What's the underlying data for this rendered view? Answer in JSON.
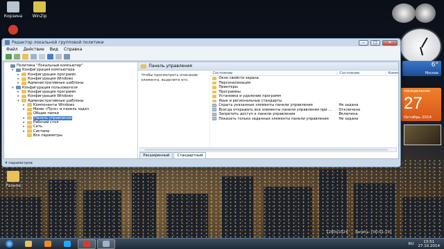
{
  "desktop_icons": [
    {
      "label": "Корзина",
      "color": "#b8c4d0"
    },
    {
      "label": "WinZip",
      "color": "#d9c24a"
    },
    {
      "label": "Разное",
      "color": "#e9c05a"
    }
  ],
  "window": {
    "title": "Редактор локальной групповой политики",
    "controls": {
      "minimize": "–",
      "maximize": "□",
      "close": "✕"
    },
    "menu": [
      "Файл",
      "Действие",
      "Вид",
      "Справка"
    ],
    "status": "4 параметров"
  },
  "tree": [
    {
      "label": "Политика \"Локальный компьютер\"",
      "level": 0,
      "icon": "computer-icon",
      "expander": ""
    },
    {
      "label": "Конфигурация компьютера",
      "level": 1,
      "icon": "computer-icon",
      "expander": "▸"
    },
    {
      "label": "Конфигурация программ",
      "level": 2,
      "icon": "folder-icon",
      "expander": "▸"
    },
    {
      "label": "Конфигурация Windows",
      "level": 2,
      "icon": "folder-icon",
      "expander": "▸"
    },
    {
      "label": "Административные шаблоны",
      "level": 2,
      "icon": "folder-icon",
      "expander": "▸"
    },
    {
      "label": "Конфигурация пользователя",
      "level": 1,
      "icon": "computer-icon",
      "expander": "▾"
    },
    {
      "label": "Конфигурация программ",
      "level": 2,
      "icon": "folder-icon",
      "expander": "▸"
    },
    {
      "label": "Конфигурация Windows",
      "level": 2,
      "icon": "folder-icon",
      "expander": "▸"
    },
    {
      "label": "Административные шаблоны",
      "level": 2,
      "icon": "folder-icon",
      "expander": "▾"
    },
    {
      "label": "Компоненты Windows",
      "level": 3,
      "icon": "folder-icon",
      "expander": "▸"
    },
    {
      "label": "Меню «Пуск» и панель задач",
      "level": 3,
      "icon": "folder-icon",
      "expander": "▸"
    },
    {
      "label": "Общие папки",
      "level": 3,
      "icon": "folder-icon",
      "expander": ""
    },
    {
      "label": "Панель управления",
      "level": 3,
      "icon": "folder-icon",
      "expander": "▸",
      "selected": true
    },
    {
      "label": "Рабочий стол",
      "level": 3,
      "icon": "folder-icon",
      "expander": "▸"
    },
    {
      "label": "Сеть",
      "level": 3,
      "icon": "folder-icon",
      "expander": "▸"
    },
    {
      "label": "Система",
      "level": 3,
      "icon": "folder-icon",
      "expander": "▸"
    },
    {
      "label": "Все параметры",
      "level": 3,
      "icon": "folder-icon",
      "expander": ""
    }
  ],
  "right_pane": {
    "header": "Панель управления",
    "description": "Чтобы просмотреть описание элемента, выделите его.",
    "columns": {
      "name": "Состояние",
      "state": "Состояние",
      "comment": "Комм"
    },
    "items": [
      {
        "name": "Окно свойств экрана",
        "state": "",
        "type": "folder"
      },
      {
        "name": "Персонализация",
        "state": "",
        "type": "folder"
      },
      {
        "name": "Принтеры",
        "state": "",
        "type": "folder"
      },
      {
        "name": "Программы",
        "state": "",
        "type": "folder"
      },
      {
        "name": "Установка и удаление программ",
        "state": "",
        "type": "folder"
      },
      {
        "name": "Язык и региональные стандарты",
        "state": "",
        "type": "folder"
      },
      {
        "name": "Скрыть указанные элементы панели управления",
        "state": "Не задана",
        "type": "policy"
      },
      {
        "name": "Всегда открывать все элементы панели управления при ...",
        "state": "Отключена",
        "type": "policy"
      },
      {
        "name": "Запретить доступ к панели управления",
        "state": "Включена",
        "type": "policy"
      },
      {
        "name": "Показать только заданные элементы панели управления",
        "state": "Не задана",
        "type": "policy"
      }
    ],
    "tabs": [
      {
        "label": "Расширенный",
        "active": false
      },
      {
        "label": "Стандартный",
        "active": true
      }
    ]
  },
  "gadgets": {
    "weather": {
      "temp": "6°",
      "city": "Москва"
    },
    "calendar": {
      "dow": "понедельник",
      "day": "27",
      "month": "Октябрь 2014"
    }
  },
  "infobar": {
    "resolution": "1280x1024",
    "record": "Запись: [00:01:19]"
  },
  "taskbar": {
    "apps": [
      {
        "name": "explorer-icon",
        "color": "#e9c05a",
        "active": false
      },
      {
        "name": "media-player-icon",
        "color": "#f08a1f",
        "active": false
      },
      {
        "name": "skype-icon",
        "color": "#1ea8ff",
        "active": false
      },
      {
        "name": "recorder-icon",
        "color": "#d93b2b",
        "active": true
      },
      {
        "name": "policy-editor-icon",
        "color": "#9fb3c9",
        "active": true
      }
    ],
    "lang": "RU",
    "time": "13:51",
    "date": "27.10.2014"
  },
  "colors": {
    "selection": "#3a7bd5",
    "accent": "#2b5f9a"
  }
}
